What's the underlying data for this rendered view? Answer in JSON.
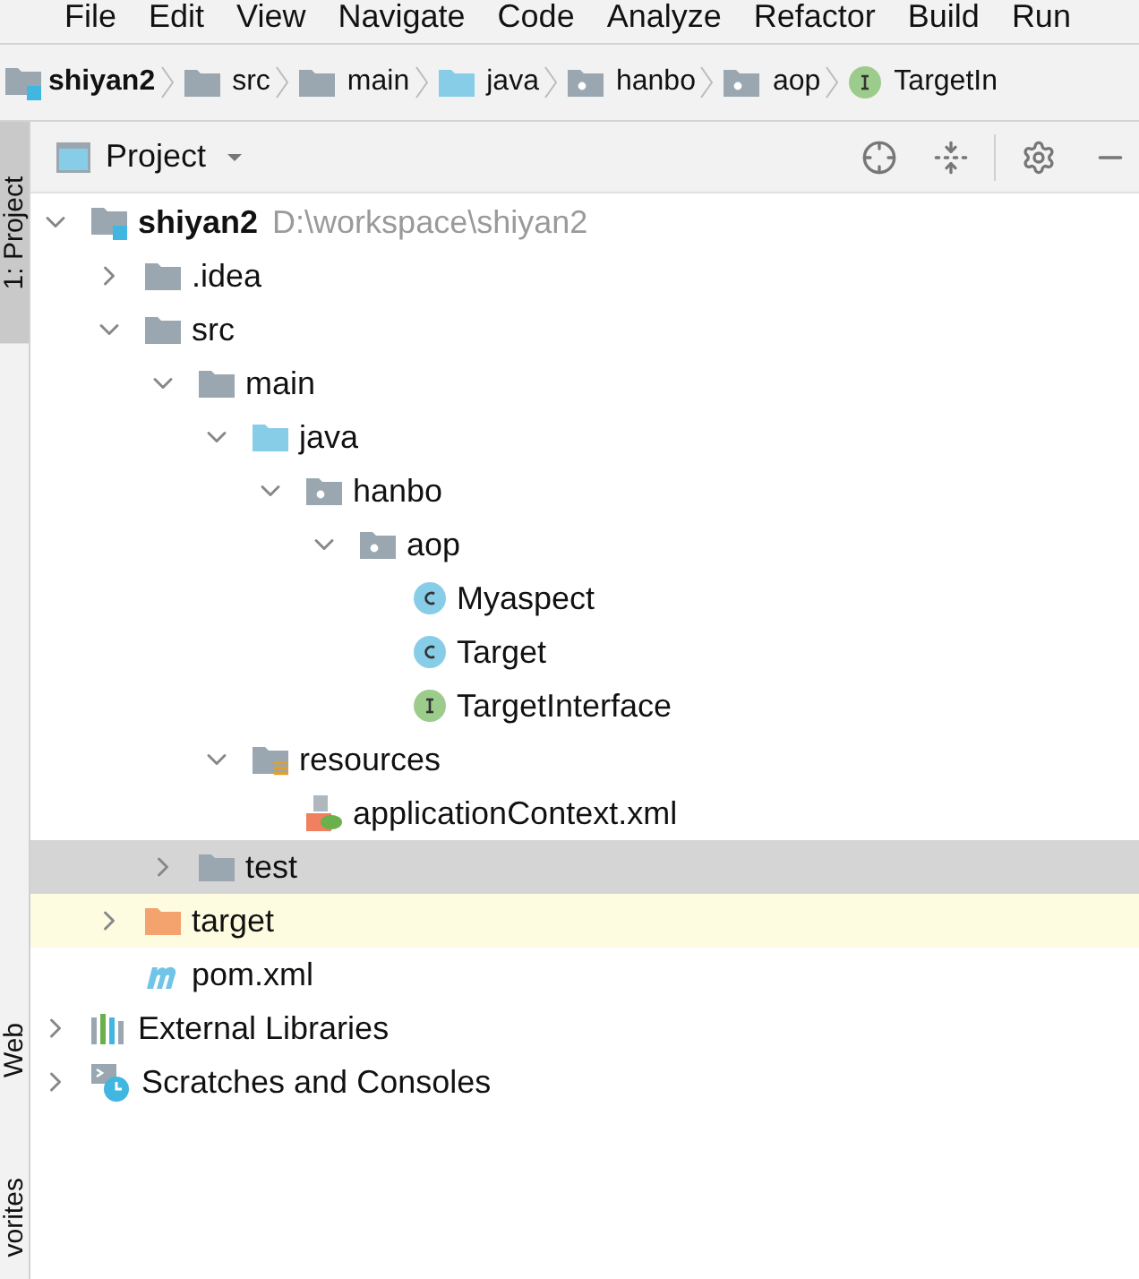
{
  "menu_bar": [
    "File",
    "Edit",
    "View",
    "Navigate",
    "Code",
    "Analyze",
    "Refactor",
    "Build",
    "Run"
  ],
  "breadcrumbs": [
    {
      "label": "shiyan2",
      "kind": "project"
    },
    {
      "label": "src",
      "kind": "folder"
    },
    {
      "label": "main",
      "kind": "folder"
    },
    {
      "label": "java",
      "kind": "source"
    },
    {
      "label": "hanbo",
      "kind": "package"
    },
    {
      "label": "aop",
      "kind": "package"
    },
    {
      "label": "TargetIn",
      "kind": "interface"
    }
  ],
  "side_tabs": [
    {
      "label": "1: Project",
      "selected": true
    },
    {
      "label": "Web",
      "selected": false
    },
    {
      "label": "vorites",
      "selected": false
    }
  ],
  "panel": {
    "title": "Project"
  },
  "tree": [
    {
      "name": "shiyan2",
      "path": "D:\\workspace\\shiyan2",
      "kind": "project",
      "expanded": true,
      "selected": false,
      "excluded": false,
      "children": [
        {
          "name": ".idea",
          "kind": "folder",
          "expanded": false,
          "selected": false,
          "excluded": false
        },
        {
          "name": "src",
          "kind": "folder",
          "expanded": true,
          "selected": false,
          "excluded": false,
          "children": [
            {
              "name": "main",
              "kind": "folder",
              "expanded": true,
              "selected": false,
              "excluded": false,
              "children": [
                {
                  "name": "java",
                  "kind": "source",
                  "expanded": true,
                  "selected": false,
                  "excluded": false,
                  "children": [
                    {
                      "name": "hanbo",
                      "kind": "package",
                      "expanded": true,
                      "selected": false,
                      "excluded": false,
                      "children": [
                        {
                          "name": "aop",
                          "kind": "package",
                          "expanded": true,
                          "selected": false,
                          "excluded": false,
                          "children": [
                            {
                              "name": "Myaspect",
                              "kind": "class",
                              "selected": false,
                              "excluded": false
                            },
                            {
                              "name": "Target",
                              "kind": "class",
                              "selected": false,
                              "excluded": false
                            },
                            {
                              "name": "TargetInterface",
                              "kind": "interface",
                              "selected": false,
                              "excluded": false
                            }
                          ]
                        }
                      ]
                    }
                  ]
                },
                {
                  "name": "resources",
                  "kind": "resources",
                  "expanded": true,
                  "selected": false,
                  "excluded": false,
                  "children": [
                    {
                      "name": "applicationContext.xml",
                      "kind": "xml",
                      "selected": false,
                      "excluded": false
                    }
                  ]
                }
              ]
            },
            {
              "name": "test",
              "kind": "folder",
              "expanded": false,
              "selected": true,
              "excluded": false
            }
          ]
        },
        {
          "name": "target",
          "kind": "excluded",
          "expanded": false,
          "selected": false,
          "excluded": true
        },
        {
          "name": "pom.xml",
          "kind": "maven",
          "selected": false,
          "excluded": false
        }
      ]
    },
    {
      "name": "External Libraries",
      "kind": "libraries",
      "expanded": false,
      "selected": false,
      "excluded": false
    },
    {
      "name": "Scratches and Consoles",
      "kind": "scratches",
      "expanded": false,
      "selected": false,
      "excluded": false
    }
  ]
}
